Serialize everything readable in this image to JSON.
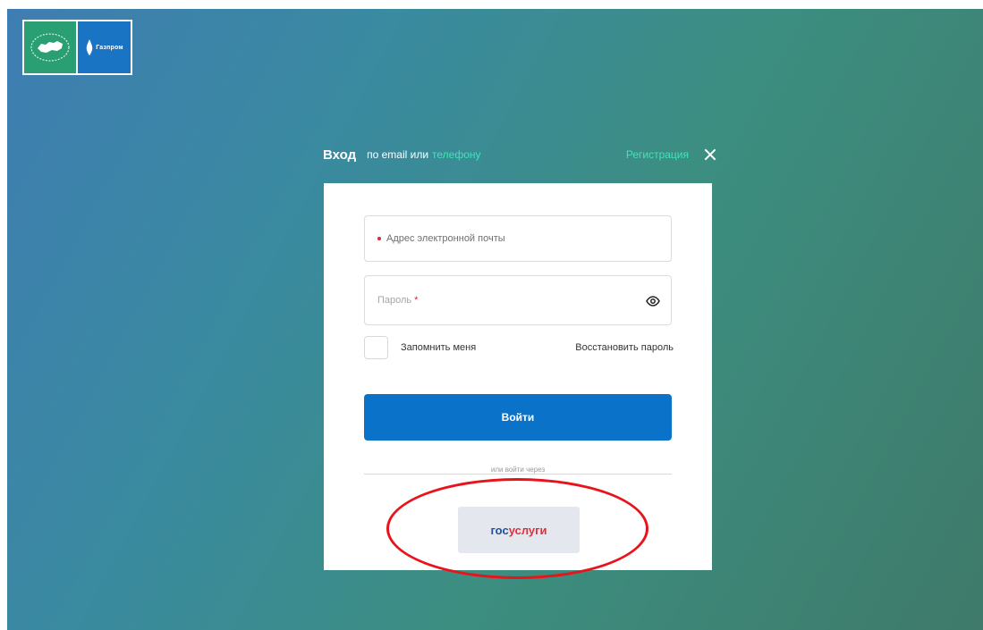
{
  "header": {
    "title": "Вход",
    "subtitle": "по email или",
    "subtitle_link": "телефону",
    "register_link": "Регистрация"
  },
  "form": {
    "email_placeholder": "Адрес электронной почты",
    "password_placeholder": "Пароль",
    "required_mark": "*",
    "remember_label": "Запомнить меня",
    "restore_link": "Восстановить пароль",
    "login_button": "Войти",
    "alt_login_text": "или войти через",
    "gosuslugi_part1": "гос",
    "gosuslugi_part2": "услуги"
  },
  "logos": {
    "partner": "Газпром"
  },
  "colors": {
    "accent_link": "#3ee5b8",
    "primary_button": "#0a72c9",
    "required": "#d9263e",
    "annotation": "#e8141c",
    "gosuslugi_blue": "#1e4fa0",
    "gosuslugi_red": "#ea2a38"
  }
}
